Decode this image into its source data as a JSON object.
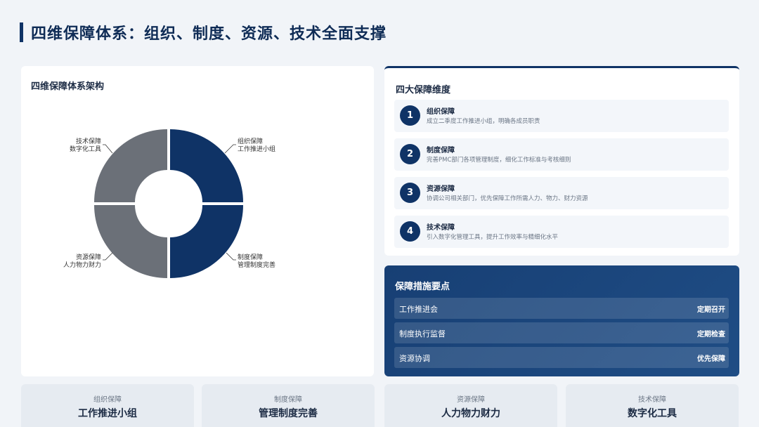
{
  "page_title": "四维保障体系：组织、制度、资源、技术全面支撑",
  "chart_card": {
    "title": "四维保障体系架构",
    "segments": [
      {
        "line1": "组织保障",
        "line2": "工作推进小组",
        "color": "#0f3366"
      },
      {
        "line1": "制度保障",
        "line2": "管理制度完善",
        "color": "#0f3366"
      },
      {
        "line1": "资源保障",
        "line2": "人力物力财力",
        "color": "#6b7078"
      },
      {
        "line1": "技术保障",
        "line2": "数字化工具",
        "color": "#6b7078"
      }
    ]
  },
  "dimensions": {
    "title": "四大保障维度",
    "items": [
      {
        "num": "1",
        "name": "组织保障",
        "desc": "成立二季度工作推进小组，明确各成员职责"
      },
      {
        "num": "2",
        "name": "制度保障",
        "desc": "完善PMC部门各项管理制度，细化工作标准与考核细则"
      },
      {
        "num": "3",
        "name": "资源保障",
        "desc": "协调公司相关部门，优先保障工作所需人力、物力、财力资源"
      },
      {
        "num": "4",
        "name": "技术保障",
        "desc": "引入数字化管理工具，提升工作效率与精细化水平"
      }
    ]
  },
  "measures": {
    "title": "保障措施要点",
    "rows": [
      {
        "label": "工作推进会",
        "value": "定期召开"
      },
      {
        "label": "制度执行监督",
        "value": "定期检查"
      },
      {
        "label": "资源协调",
        "value": "优先保障"
      }
    ]
  },
  "tiles": [
    {
      "sub": "组织保障",
      "main": "工作推进小组"
    },
    {
      "sub": "制度保障",
      "main": "管理制度完善"
    },
    {
      "sub": "资源保障",
      "main": "人力物力财力"
    },
    {
      "sub": "技术保障",
      "main": "数字化工具"
    }
  ]
}
